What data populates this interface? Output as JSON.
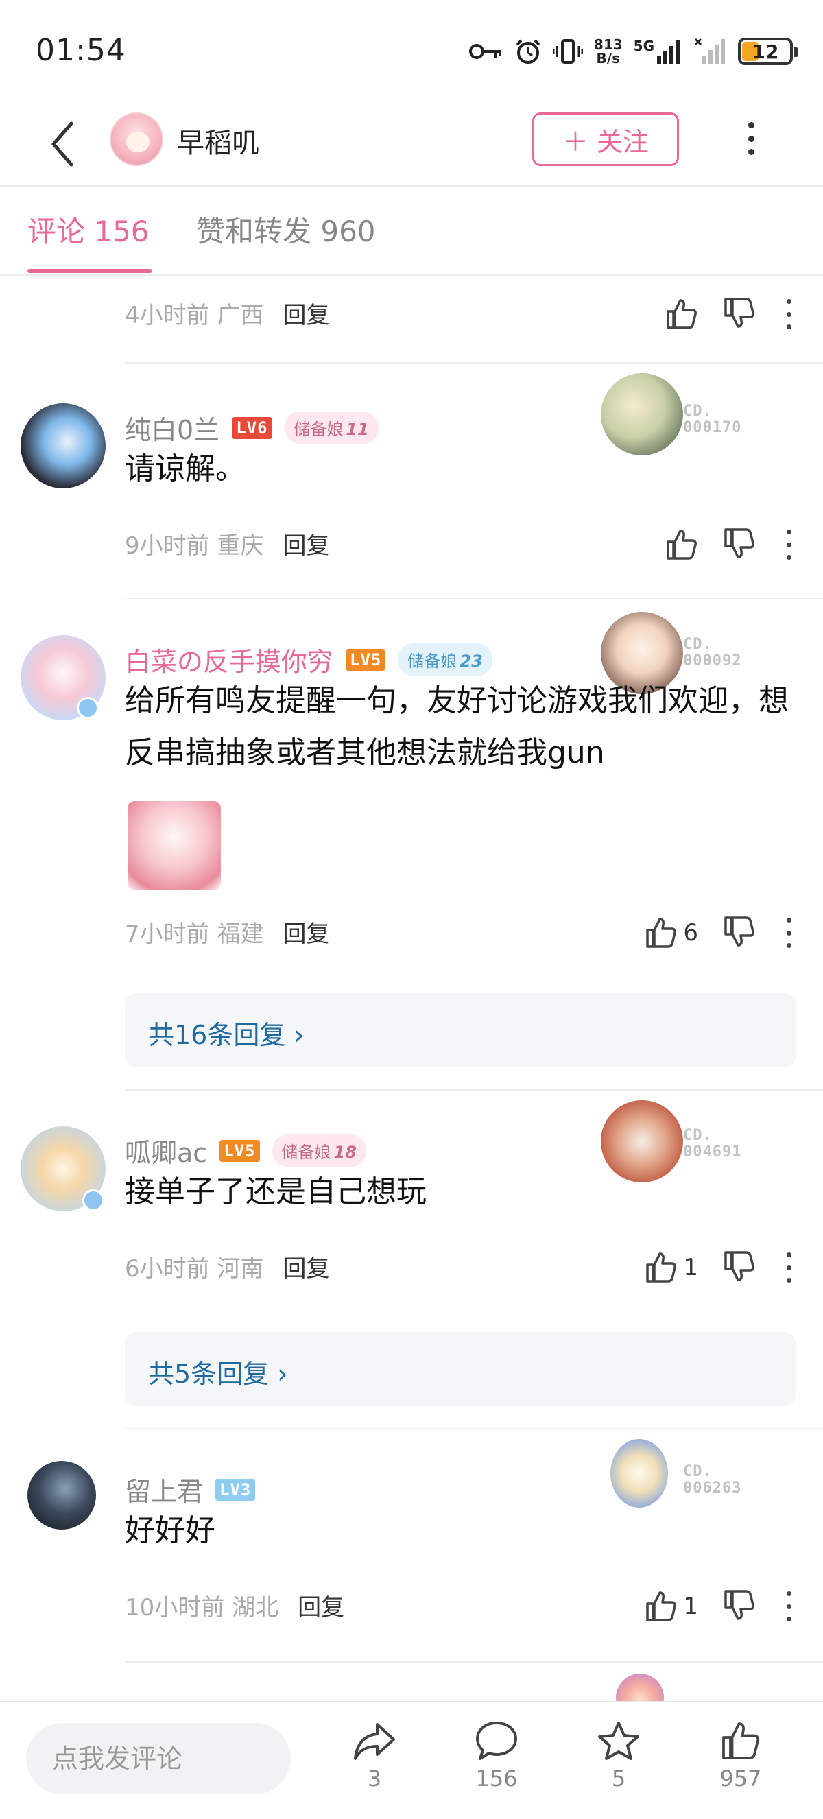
{
  "status": {
    "time": "01:54",
    "net_speed_top": "813",
    "net_speed_bottom": "B/s",
    "network": "5G",
    "battery": "12"
  },
  "header": {
    "username": "早稻叽",
    "follow_label": "＋ 关注"
  },
  "tabs": {
    "comments": "评论 156",
    "likes_shares": "赞和转发 960"
  },
  "comments": [
    {
      "meta": "4小时前  广西",
      "reply": "回复",
      "likes": ""
    },
    {
      "username": "纯白0兰",
      "level": "LV6",
      "badge": "储备娘",
      "badge_num": "11",
      "text": "请谅解。",
      "fan_id_top": "CD.",
      "fan_id_bottom": "000170",
      "meta": "9小时前  重庆",
      "reply": "回复",
      "likes": ""
    },
    {
      "username": "白菜の反手摸你穷",
      "level": "LV5",
      "badge": "储备娘",
      "badge_num": "23",
      "text": "给所有鸣友提醒一句，友好讨论游戏我们欢迎，想反串搞抽象或者其他想法就给我gun",
      "fan_id_top": "CD.",
      "fan_id_bottom": "000092",
      "meta": "7小时前  福建",
      "reply": "回复",
      "likes": "6",
      "replies_link": "共16条回复 ›"
    },
    {
      "username": "呱卿ac",
      "level": "LV5",
      "badge": "储备娘",
      "badge_num": "18",
      "text": "接单子了还是自己想玩",
      "fan_id_top": "CD.",
      "fan_id_bottom": "004691",
      "meta": "6小时前  河南",
      "reply": "回复",
      "likes": "1",
      "replies_link": "共5条回复 ›"
    },
    {
      "username": "留上君",
      "level": "LV3",
      "text": "好好好",
      "fan_id_top": "CD.",
      "fan_id_bottom": "006263",
      "meta": "10小时前  湖北",
      "reply": "回复",
      "likes": "1"
    }
  ],
  "bottom": {
    "comment_placeholder": "点我发评论",
    "share_count": "3",
    "comment_count": "156",
    "fav_count": "5",
    "like_count": "957"
  },
  "colors": {
    "accent": "#e86a93",
    "link": "#1e6aa1",
    "muted": "#aaaaaa"
  }
}
